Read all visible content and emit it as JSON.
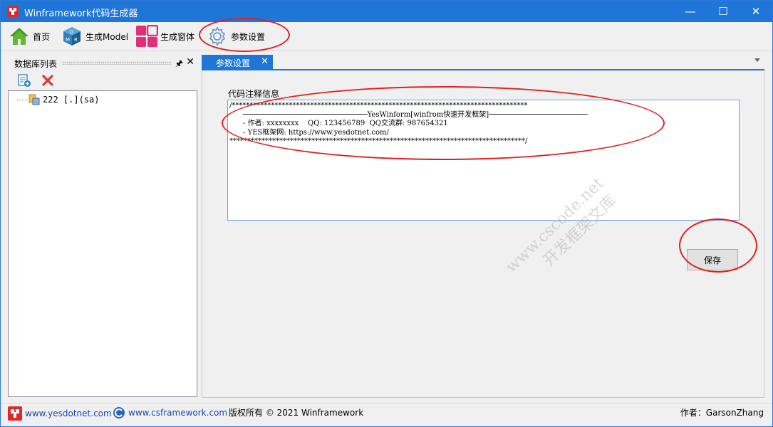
{
  "window": {
    "title": "Winframework代码生成器",
    "minimize": "—",
    "maximize": "☐",
    "close": "✕"
  },
  "toolbar": {
    "home_label": "首页",
    "model_label": "生成Model",
    "form_label": "生成窗体",
    "settings_label": "参数设置"
  },
  "left_panel": {
    "title": "数据库列表",
    "pin": "🖈",
    "close": "✕",
    "tree": [
      {
        "label": "222 [.](sa)"
      }
    ]
  },
  "document": {
    "tab_label": "参数设置",
    "tab_close": "✕",
    "field_label": "代码注释信息",
    "comment_text": "/***********************************************************************************\n      ─────────────────────────────YesWinform[winfrom快速开发框架]───────────────────────\n      - 作者: xxxxxxxx    QQ: 123456789  QQ交流群: 987654321\n      - YES框架网: https://www.yesdotnet.com/\n***********************************************************************************/",
    "save_label": "保存",
    "watermark_line1": "www.cscode.net",
    "watermark_line2": "开发框架文库"
  },
  "statusbar": {
    "link1": "www.yesdotnet.com",
    "link2": "www.csframework.com",
    "copyright": "版权所有 © 2021 Winframework",
    "author": "作者：GarsonZhang"
  },
  "colors": {
    "titlebar": "#1f76d8",
    "accent_red": "#e02020",
    "link": "#1a47b8"
  }
}
